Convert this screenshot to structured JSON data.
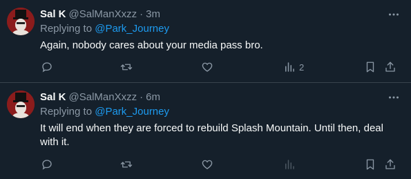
{
  "tweets": [
    {
      "display_name": "Sal K",
      "handle": "@SalManXxzz",
      "separator": "·",
      "time": "3m",
      "replying_prefix": "Replying to",
      "replying_to": "@Park_Journey",
      "text": "Again, nobody cares about your media pass bro.",
      "views": "2"
    },
    {
      "display_name": "Sal K",
      "handle": "@SalManXxzz",
      "separator": "·",
      "time": "6m",
      "replying_prefix": "Replying to",
      "replying_to": "@Park_Journey",
      "text": "It will end when they are forced to rebuild Splash Mountain. Until then, deal with it.",
      "views": ""
    }
  ],
  "icons": {
    "more": "more-horizontal-icon",
    "reply": "reply-icon",
    "retweet": "retweet-icon",
    "like": "heart-icon",
    "views": "analytics-icon",
    "bookmark": "bookmark-icon",
    "share": "share-icon"
  },
  "colors": {
    "background": "#15202b",
    "text": "#f7f9f9",
    "secondary": "#8b98a5",
    "accent": "#1d9bf0",
    "divider": "#38444d"
  }
}
